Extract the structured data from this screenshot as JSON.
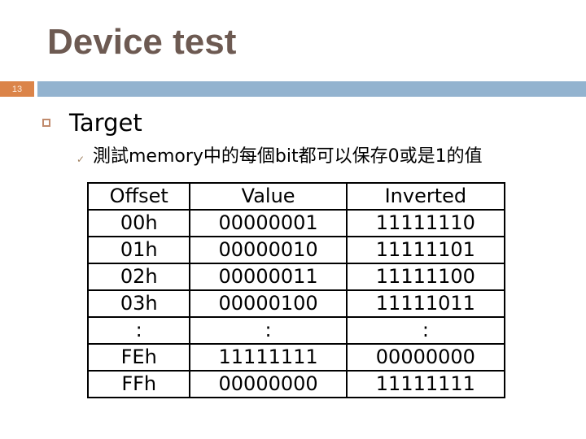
{
  "slide": {
    "title": "Device test",
    "number": "13",
    "colors": {
      "title": "#6d5a52",
      "number_badge": "#db8449",
      "header_bar": "#93b3cf",
      "bullet": "#c08a6c"
    }
  },
  "bullets": {
    "level1": {
      "icon": "hollow-square-bullet",
      "text": "Target"
    },
    "level2": {
      "icon": "checkmark-bullet",
      "text": "測試memory中的每個bit都可以保存0或是1的值"
    }
  },
  "table": {
    "headers": [
      "Offset",
      "Value",
      "Inverted"
    ],
    "rows": [
      [
        "00h",
        "00000001",
        "11111110"
      ],
      [
        "01h",
        "00000010",
        "11111101"
      ],
      [
        "02h",
        "00000011",
        "11111100"
      ],
      [
        "03h",
        "00000100",
        "11111011"
      ],
      [
        ":",
        ":",
        ":"
      ],
      [
        "FEh",
        "11111111",
        "00000000"
      ],
      [
        "FFh",
        "00000000",
        "11111111"
      ]
    ]
  }
}
